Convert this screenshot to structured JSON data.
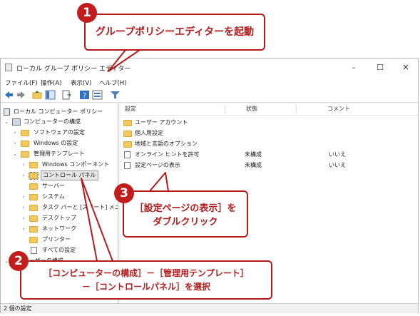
{
  "window": {
    "title": "ローカル グループ ポリシー エディター",
    "menu": [
      "ファイル(F)",
      "操作(A)",
      "表示(V)",
      "ヘルプ(H)"
    ],
    "status": "2 個の設定"
  },
  "tree": {
    "root": "ローカル コンピューター ポリシー",
    "computer_config": "コンピューターの構成",
    "software_settings": "ソフトウェアの設定",
    "windows_settings": "Windows の設定",
    "admin_templates": "管理用テンプレート",
    "windows_components": "Windows コンポーネント",
    "control_panel": "コントロール パネル",
    "server": "サーバー",
    "system": "システム",
    "taskbar": "タスク バーと [スタート] メニュー",
    "desktop": "デスクトップ",
    "network": "ネットワーク",
    "printers": "プリンター",
    "all_settings": "すべての設定",
    "user_config": "ユーザーの構成"
  },
  "list": {
    "headers": {
      "setting": "設定",
      "state": "状態",
      "comment": "コメント"
    },
    "folders": [
      "ユーザー アカウント",
      "個人用設定",
      "地域と言語のオプション"
    ],
    "settings": [
      {
        "name": "オンライン ヒントを許可",
        "state": "未構成",
        "comment": "いいえ"
      },
      {
        "name": "設定ページの表示",
        "state": "未構成",
        "comment": "いいえ"
      }
    ]
  },
  "callouts": {
    "c1": {
      "num": "1",
      "text": "グループポリシーエディターを起動"
    },
    "c2": {
      "num": "2",
      "line1": "［コンピューターの構成］－［管理用テンプレート］",
      "line2": "－［コントロールパネル］を選択"
    },
    "c3": {
      "num": "3",
      "line1": "［設定ページの表示］を",
      "line2": "ダブルクリック"
    }
  },
  "colors": {
    "accent": "#b31b1b",
    "folder": "#f2c95c"
  }
}
